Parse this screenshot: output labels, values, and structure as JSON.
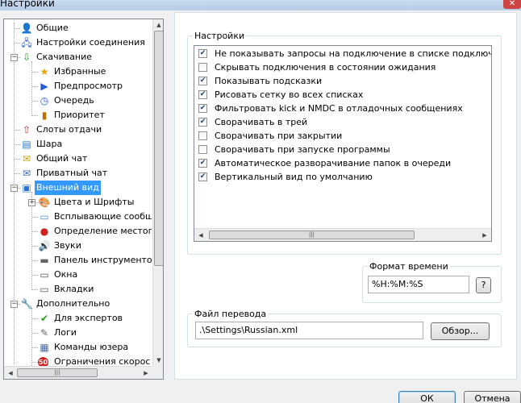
{
  "window": {
    "title": "Настройки",
    "close_glyph": "✕"
  },
  "tree": {
    "items": [
      {
        "label": "Общие",
        "icon": "user-settings-icon",
        "glyph": "👤"
      },
      {
        "label": "Настройки соединения",
        "icon": "network-icon",
        "glyph": "🖧"
      },
      {
        "label": "Скачивание",
        "icon": "download-icon",
        "glyph": "⇩",
        "expander": "−"
      },
      {
        "label": "Избранные",
        "icon": "star-icon",
        "glyph": "★"
      },
      {
        "label": "Предпросмотр",
        "icon": "play-icon",
        "glyph": "▶"
      },
      {
        "label": "Очередь",
        "icon": "queue-icon",
        "glyph": "◷"
      },
      {
        "label": "Приоритет",
        "icon": "priority-icon",
        "glyph": "▮"
      },
      {
        "label": "Слоты отдачи",
        "icon": "upload-slots-icon",
        "glyph": "⇧"
      },
      {
        "label": "Шара",
        "icon": "share-icon",
        "glyph": "▤"
      },
      {
        "label": "Общий чат",
        "icon": "chat-icon",
        "glyph": "✉"
      },
      {
        "label": "Приватный чат",
        "icon": "private-chat-icon",
        "glyph": "✉"
      },
      {
        "label": "Внешний вид",
        "icon": "appearance-icon",
        "glyph": "▣",
        "expander": "−",
        "selected": true
      },
      {
        "label": "Цвета и Шрифты",
        "icon": "colors-fonts-icon",
        "glyph": "🎨",
        "expander": "+"
      },
      {
        "label": "Всплывающие сообщ",
        "icon": "popup-icon",
        "glyph": "▭"
      },
      {
        "label": "Определение местоп",
        "icon": "location-icon",
        "glyph": "●"
      },
      {
        "label": "Звуки",
        "icon": "speaker-icon",
        "glyph": "🔊"
      },
      {
        "label": "Панель инструменто",
        "icon": "toolbar-icon",
        "glyph": "▬"
      },
      {
        "label": "Окна",
        "icon": "windows-icon",
        "glyph": "▭"
      },
      {
        "label": "Вкладки",
        "icon": "tabs-icon",
        "glyph": "▭"
      },
      {
        "label": "Дополнительно",
        "icon": "tools-icon",
        "glyph": "🔧",
        "expander": "−"
      },
      {
        "label": "Для экспертов",
        "icon": "checkmark-icon",
        "glyph": "✔"
      },
      {
        "label": "Логи",
        "icon": "pencil-icon",
        "glyph": "✎"
      },
      {
        "label": "Команды юзера",
        "icon": "user-commands-icon",
        "glyph": "▦"
      },
      {
        "label": "Ограничения скорос",
        "icon": "speed-limit-icon",
        "glyph": "50"
      }
    ],
    "arrow_up": "▲",
    "arrow_down": "▼",
    "arrow_left": "◀",
    "arrow_right": "▶",
    "grip": "|||"
  },
  "settings": {
    "legend": "Настройки",
    "options": [
      {
        "label": "Не показывать запросы на подключение в списке подключений (у",
        "checked": true
      },
      {
        "label": "Скрывать подключения в состоянии ожидания",
        "checked": false
      },
      {
        "label": "Показывать подсказки",
        "checked": true
      },
      {
        "label": "Рисовать сетку во всех списках",
        "checked": true
      },
      {
        "label": "Фильтровать kick и NMDC в отладочных сообщениях",
        "checked": true
      },
      {
        "label": "Сворачивать в трей",
        "checked": true
      },
      {
        "label": "Сворачивать при закрытии",
        "checked": false
      },
      {
        "label": "Сворачивать при запуске программы",
        "checked": false
      },
      {
        "label": "Автоматическое разворачивание папок в очереди",
        "checked": true
      },
      {
        "label": "Вертикальный вид по умолчанию",
        "checked": true
      }
    ],
    "check_glyph": "✔",
    "arrow_left": "◀",
    "arrow_right": "▶",
    "grip": "|||"
  },
  "time_format": {
    "legend": "Формат времени",
    "value": "%H:%M:%S",
    "help_label": "?"
  },
  "translation_file": {
    "legend": "Файл перевода",
    "value": ".\\Settings\\Russian.xml",
    "browse_label": "Обзор..."
  },
  "footer": {
    "ok_label": "ОК",
    "cancel_label": "Отмена"
  }
}
